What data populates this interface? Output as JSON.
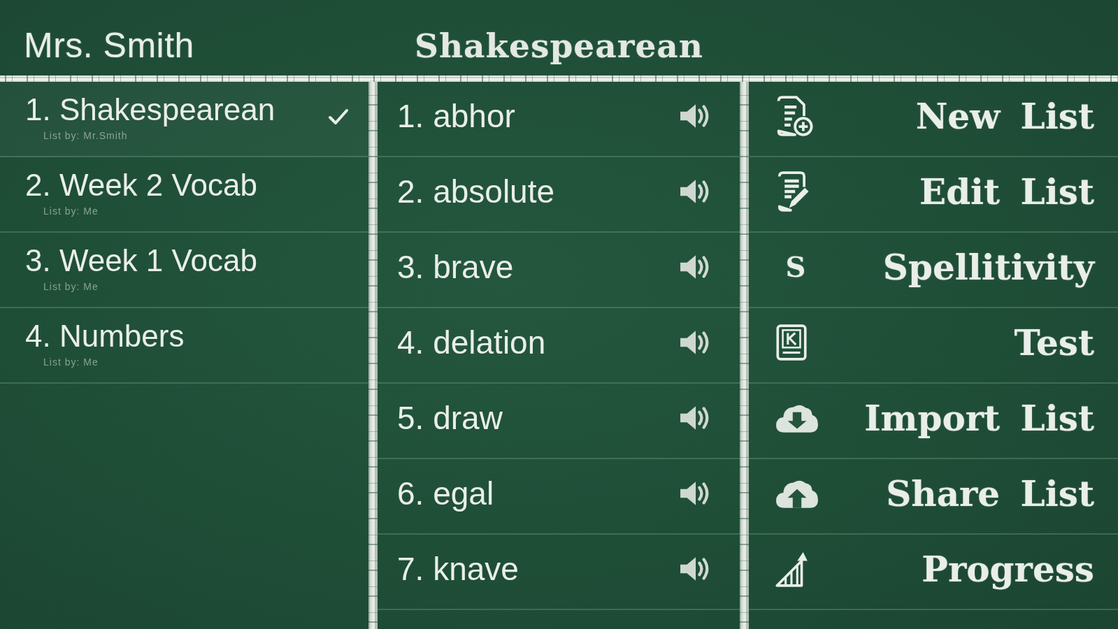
{
  "header": {
    "teacher": "Mrs. Smith",
    "title": "Shakespearean"
  },
  "lists": [
    {
      "label": "1. Shakespearean",
      "author": "List by: Mr.Smith",
      "selected": true
    },
    {
      "label": "2. Week 2 Vocab",
      "author": "List by: Me",
      "selected": false
    },
    {
      "label": "3. Week 1 Vocab",
      "author": "List by: Me",
      "selected": false
    },
    {
      "label": "4. Numbers",
      "author": "List by: Me",
      "selected": false
    }
  ],
  "words": [
    "1. abhor",
    "2. absolute",
    "3. brave",
    "4. delation",
    "5. draw",
    "6. egal",
    "7. knave"
  ],
  "actions": [
    {
      "kind": "new",
      "label": "New List"
    },
    {
      "kind": "edit",
      "label": "Edit List"
    },
    {
      "kind": "letter",
      "glyph": "S",
      "label": "Spellitivity"
    },
    {
      "kind": "test",
      "label": "Test"
    },
    {
      "kind": "import",
      "label": "Import List"
    },
    {
      "kind": "share",
      "label": "Share List"
    },
    {
      "kind": "progress",
      "label": "Progress"
    }
  ]
}
